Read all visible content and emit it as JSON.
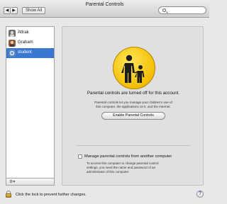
{
  "window": {
    "title": "Parental Controls"
  },
  "toolbar": {
    "back_label": "◀",
    "forward_label": "▶",
    "show_all_label": "Show All",
    "search_value": "",
    "search_placeholder": ""
  },
  "sidebar": {
    "users": [
      {
        "name": "Attrak",
        "selected": false
      },
      {
        "name": "Graham",
        "selected": false
      },
      {
        "name": "student",
        "selected": true
      }
    ],
    "footer_gear_label": "⚙▾"
  },
  "main": {
    "status_title": "Parental controls are turned off for this account.",
    "description_line1": "Parental controls let you manage your children’s use of",
    "description_line2": "this computer, the applications on it, and the Internet.",
    "enable_button_label": "Enable Parental Controls",
    "manage_checkbox_label": "Manage parental controls from another computer",
    "manage_checked": false,
    "access_text_line1": "To access this computer to change parental control",
    "access_text_line2": "settings, you need the name and password of an",
    "access_text_line3": "administrator of this computer."
  },
  "footer": {
    "lock_text": "Click the lock to prevent further changes.",
    "help_label": "?"
  },
  "colors": {
    "selection": "#3a77d3",
    "badge_yellow": "#f4bf00"
  }
}
